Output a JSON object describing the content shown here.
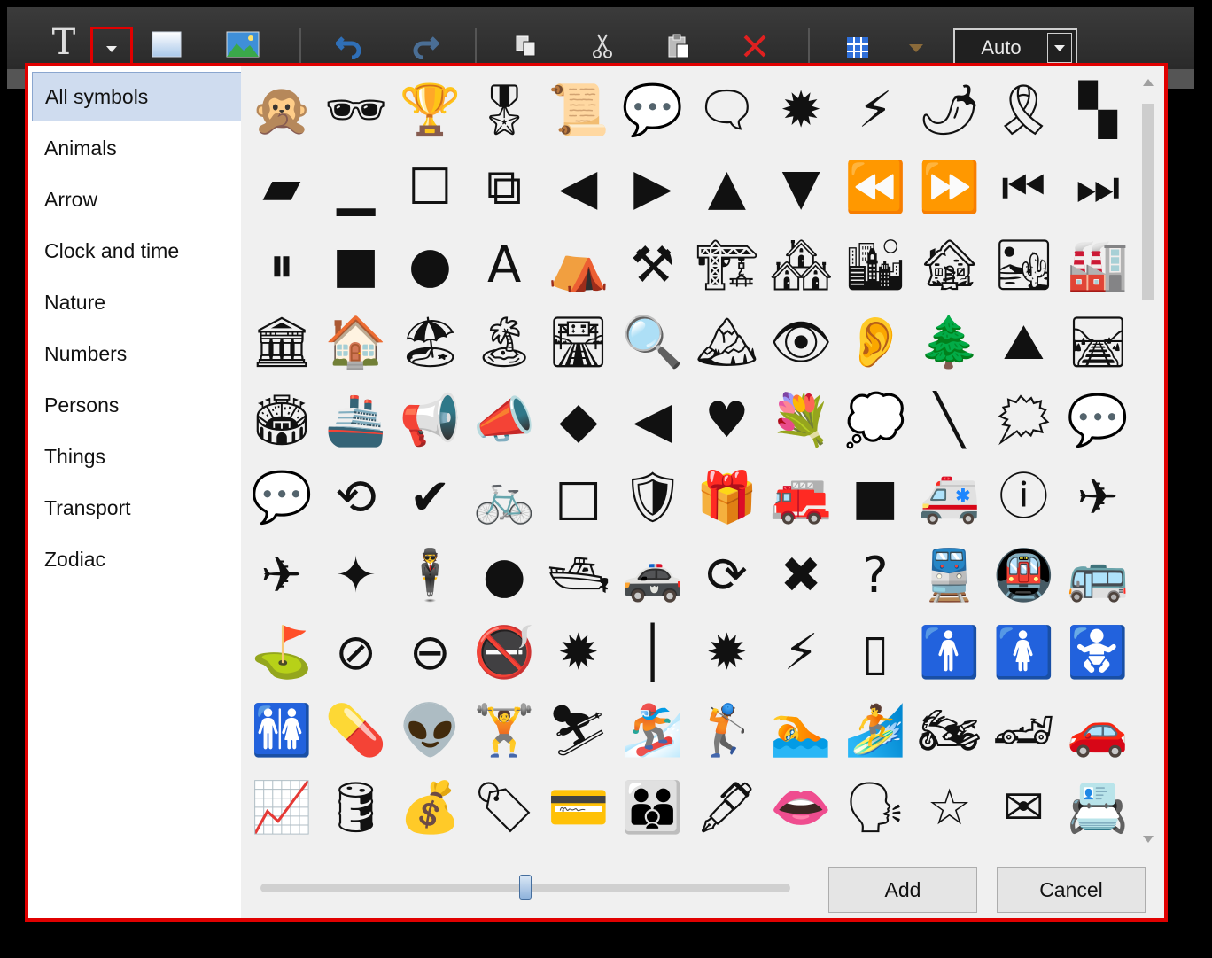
{
  "toolbar": {
    "text_tool": "T",
    "zoom_label": "Auto",
    "icons": [
      "text-icon",
      "dropdown-arrow-icon",
      "rectangle-icon",
      "image-icon",
      "undo-icon",
      "redo-icon",
      "copy-icon",
      "cut-icon",
      "paste-icon",
      "delete-icon",
      "grid-icon",
      "chevron-down-icon"
    ],
    "colors": {
      "highlight": "#e00000",
      "undo": "#2f6fb7",
      "delete": "#e02020",
      "chevron": "#8a6a3a"
    }
  },
  "sidebar": {
    "categories": [
      {
        "label": "All symbols",
        "selected": true
      },
      {
        "label": "Animals"
      },
      {
        "label": "Arrow"
      },
      {
        "label": "Clock and time"
      },
      {
        "label": "Nature"
      },
      {
        "label": "Numbers"
      },
      {
        "label": "Persons"
      },
      {
        "label": "Things"
      },
      {
        "label": "Transport"
      },
      {
        "label": "Zodiac"
      }
    ]
  },
  "symbols": [
    "🙊",
    "🕶",
    "🏆",
    "🎖",
    "📜",
    "💬",
    "🗨",
    "✹",
    "⚡",
    "🌶",
    "🎗",
    "▚",
    "▰",
    "▁",
    "☐",
    "⧉",
    "◀",
    "▶",
    "▲",
    "▼",
    "⏪",
    "⏩",
    "⏮",
    "⏭",
    "⏸",
    "■",
    "●",
    "A",
    "⛺",
    "⚒",
    "🏗",
    "🏘",
    "🏙",
    "🏚",
    "🏜",
    "🏭",
    "🏛",
    "🏠",
    "🏖",
    "🏝",
    "🛣",
    "🔍",
    "🏔",
    "👁",
    "👂",
    "🌲",
    "⛰",
    "🛤",
    "🏟",
    "🚢",
    "📢",
    "📣",
    "◆",
    "◀",
    "♥",
    "💐",
    "💭",
    "╲",
    "🗯",
    "💬",
    "💬",
    "⟲",
    "✔",
    "🚲",
    "□",
    "🛡",
    "🎁",
    "🚒",
    "■",
    "🚑",
    "ⓘ",
    "✈",
    "✈",
    "✦",
    "🕴",
    "●",
    "🛥",
    "🚓",
    "⟳",
    "✖",
    "?",
    "🚆",
    "🚇",
    "🚌",
    "⛳",
    "⊘",
    "⊖",
    "🚭",
    "✹",
    "│",
    "✹",
    "⚡",
    "▯",
    "🚹",
    "🚺",
    "🚼",
    "🚻",
    "💊",
    "👽",
    "🏋",
    "⛷",
    "🏂",
    "🏌",
    "🏊",
    "🏄",
    "🏍",
    "🏎",
    "🚗",
    "📈",
    "🛢",
    "💰",
    "🏷",
    "💳",
    "👪",
    "🖋",
    "👄",
    "🗣",
    "☆",
    "✉",
    "📇"
  ],
  "scrollbar": {
    "position": 0.12
  },
  "slider": {
    "value": 0.5
  },
  "buttons": {
    "add": "Add",
    "cancel": "Cancel"
  }
}
